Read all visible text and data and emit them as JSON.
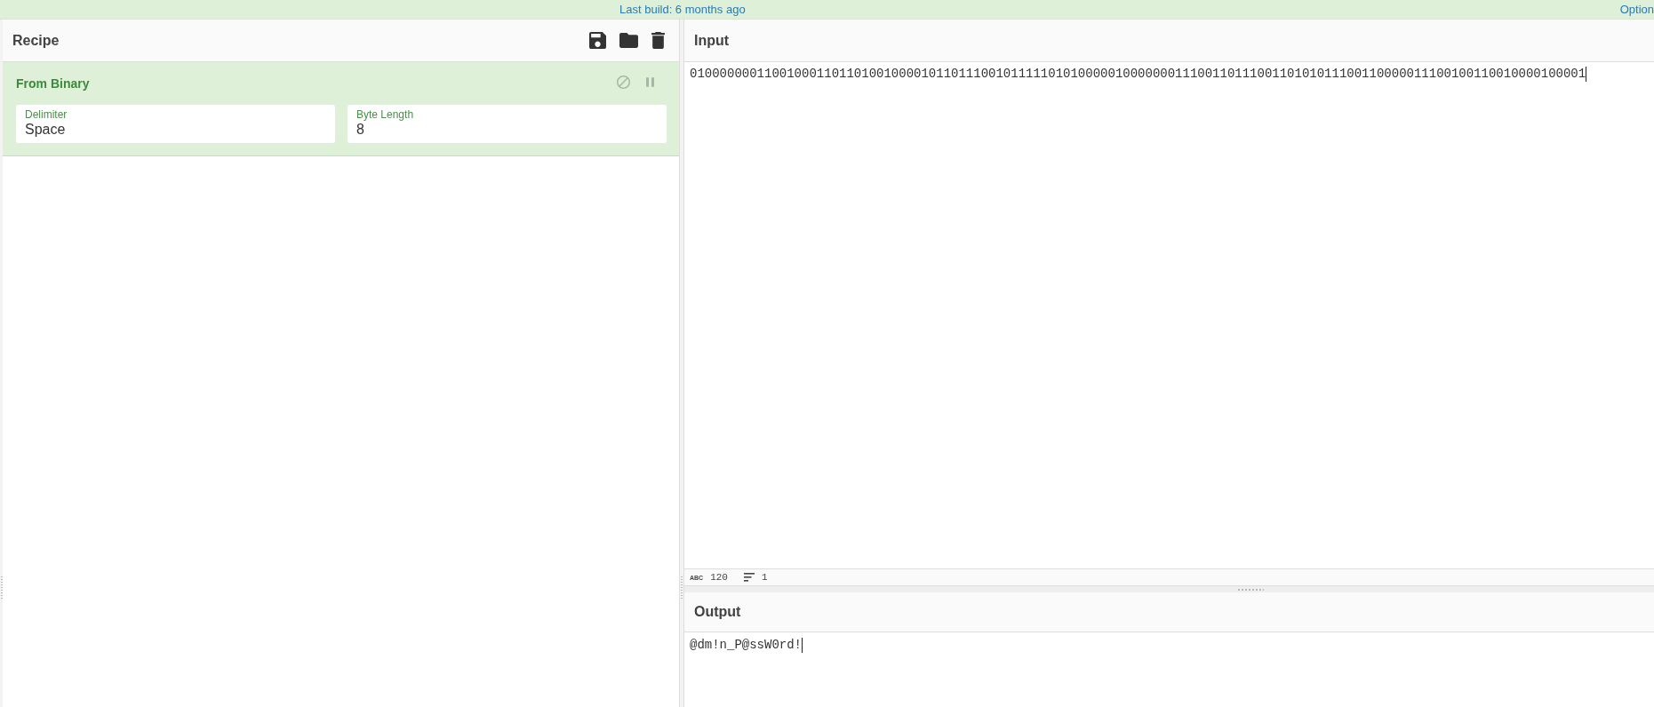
{
  "banner": {
    "build_info": "Last build: 6 months ago",
    "options_link": "Option"
  },
  "recipe": {
    "title": "Recipe",
    "operations": [
      {
        "name": "From Binary",
        "disabled": false,
        "breakpoint": false,
        "args": [
          {
            "label": "Delimiter",
            "value": "Space"
          },
          {
            "label": "Byte Length",
            "value": "8"
          }
        ]
      }
    ]
  },
  "input": {
    "title": "Input",
    "value": "010000000110010001101101001000010110111001011111010100000100000001110011011100110101011100110000011100100110010000100001",
    "status": {
      "length_icon": "ABC",
      "length": "120",
      "lines": "1"
    }
  },
  "output": {
    "title": "Output",
    "value": "@dm!n_P@ssW0rd!"
  }
}
